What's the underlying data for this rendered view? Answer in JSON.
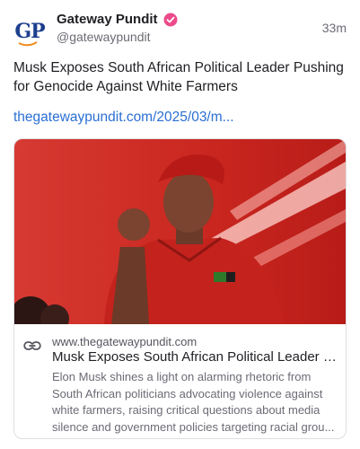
{
  "author": {
    "avatar_text": "GP",
    "display_name": "Gateway Pundit",
    "handle": "@gatewaypundit",
    "verified_icon": "verified-badge-icon"
  },
  "timestamp": "33m",
  "post": {
    "text": "Musk Exposes South African Political Leader Pushing for Genocide Against White Farmers",
    "link": "thegatewaypundit.com/2025/03/m..."
  },
  "card": {
    "image_icon": "photo-speaker-red-shirt",
    "domain": "www.thegatewaypundit.com",
    "title": "Musk Exposes South African Political Leader P...",
    "description": "Elon Musk shines a light on alarming rhetoric from South African politicians advocating violence against white farmers, raising critical questions about media silence and government policies targeting racial grou..."
  },
  "colors": {
    "brand_blue": "#1e3f8f",
    "brand_orange": "#f28c1e",
    "verified_pink": "#ec4b8b",
    "link_blue": "#2a6fd4"
  }
}
